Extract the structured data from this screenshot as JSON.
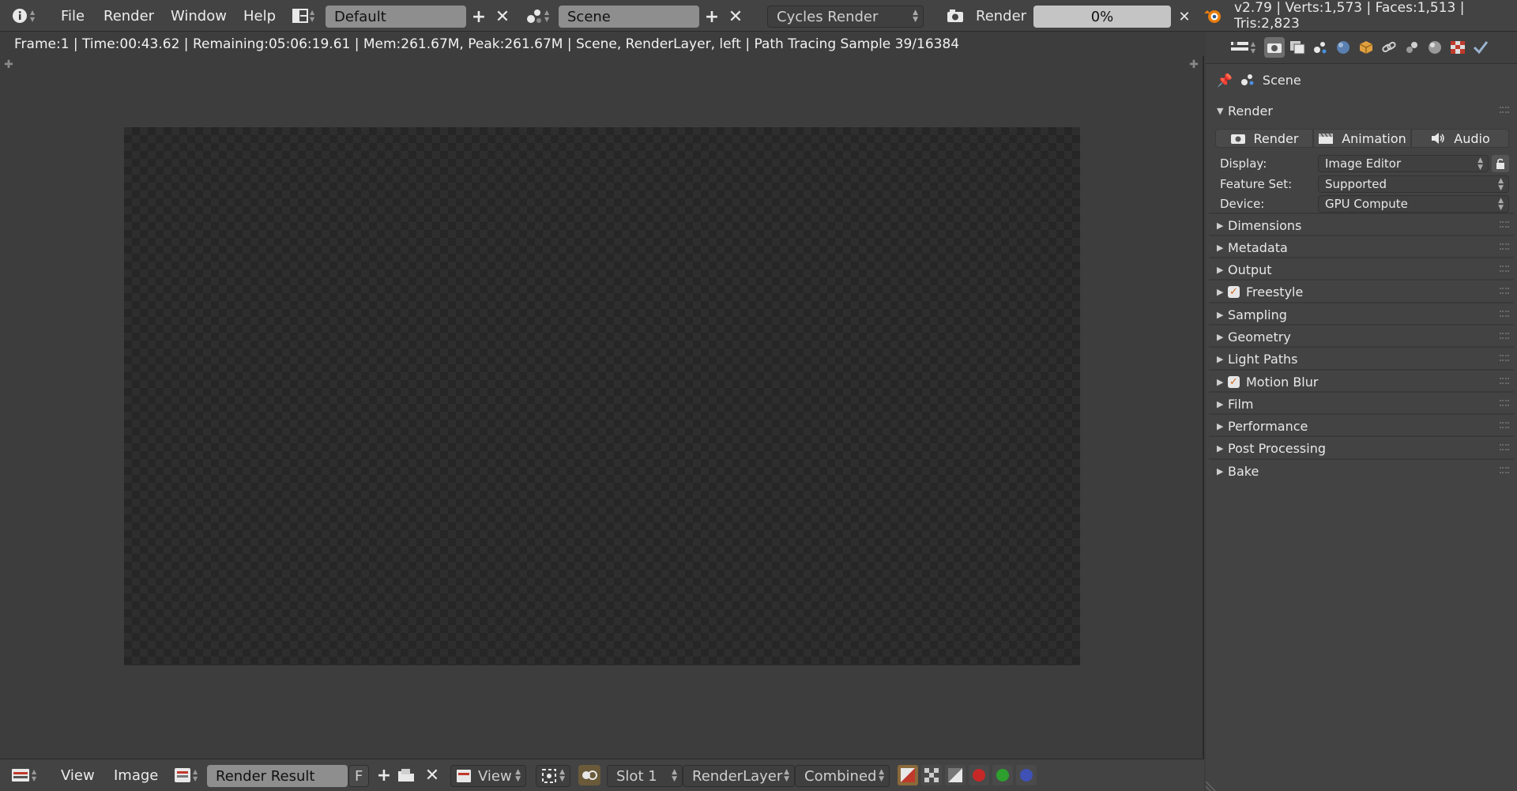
{
  "top_header": {
    "menus": [
      "File",
      "Render",
      "Window",
      "Help"
    ],
    "layout_name": "Default",
    "scene_name": "Scene",
    "engine": "Cycles Render",
    "render_label": "Render",
    "progress_text": "0%",
    "progress_fraction": 0,
    "stats": "v2.79 | Verts:1,573 | Faces:1,513 | Tris:2,823"
  },
  "editor": {
    "status_line": "Frame:1 | Time:00:43.62 | Remaining:05:06:19.61 | Mem:261.67M, Peak:261.67M | Scene, RenderLayer, left | Path Tracing Sample 39/16384"
  },
  "bottom_header": {
    "menus": [
      "View",
      "Image"
    ],
    "image_name": "Render Result",
    "fake_user": "F",
    "view_mode": "View",
    "slot": "Slot 1",
    "render_layer": "RenderLayer",
    "pass": "Combined",
    "channel_colors": [
      "#c62828",
      "#2e9e2e",
      "#3f51b5"
    ]
  },
  "properties": {
    "context": "Scene",
    "render_panel": {
      "title": "Render",
      "buttons": [
        "Render",
        "Animation",
        "Audio"
      ],
      "rows": [
        {
          "label": "Display:",
          "value": "Image Editor"
        },
        {
          "label": "Feature Set:",
          "value": "Supported"
        },
        {
          "label": "Device:",
          "value": "GPU Compute"
        }
      ]
    },
    "panels": [
      {
        "title": "Dimensions",
        "checkbox": false
      },
      {
        "title": "Metadata",
        "checkbox": false
      },
      {
        "title": "Output",
        "checkbox": false
      },
      {
        "title": "Freestyle",
        "checkbox": true
      },
      {
        "title": "Sampling",
        "checkbox": false
      },
      {
        "title": "Geometry",
        "checkbox": false
      },
      {
        "title": "Light Paths",
        "checkbox": false
      },
      {
        "title": "Motion Blur",
        "checkbox": true
      },
      {
        "title": "Film",
        "checkbox": false
      },
      {
        "title": "Performance",
        "checkbox": false
      },
      {
        "title": "Post Processing",
        "checkbox": false
      },
      {
        "title": "Bake",
        "checkbox": false
      }
    ]
  }
}
